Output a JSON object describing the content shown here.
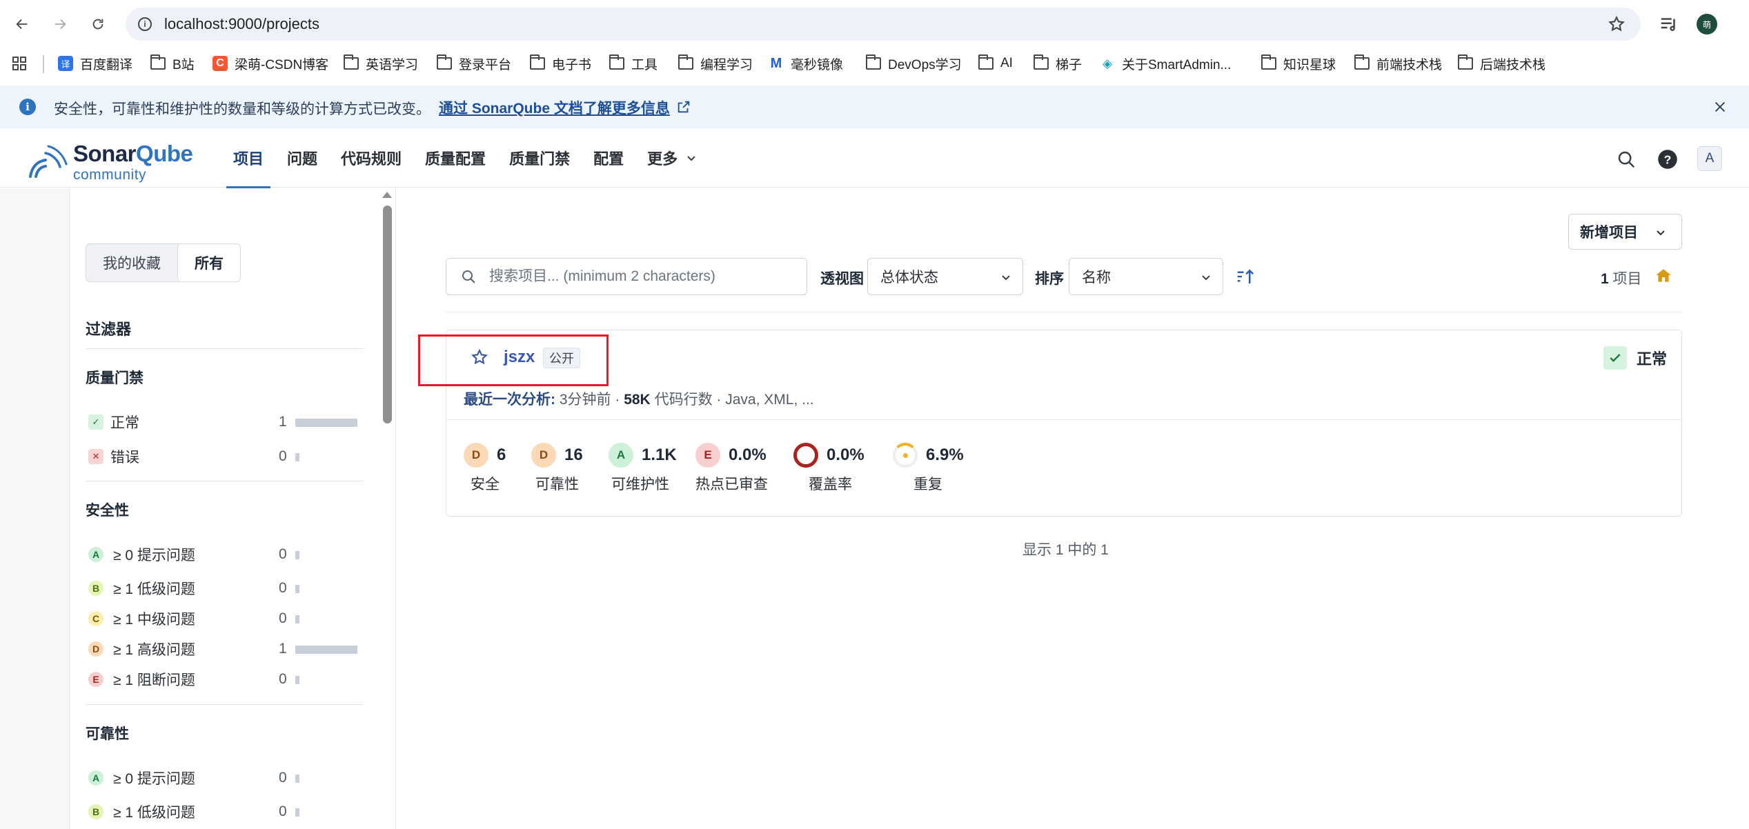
{
  "browser": {
    "url": "localhost:9000/projects",
    "profile_initial": "萌",
    "bookmarks": [
      {
        "label": "百度翻译",
        "icon": "baidu-translate-icon"
      },
      {
        "label": "B站",
        "icon": "folder-icon"
      },
      {
        "label": "梁萌-CSDN博客",
        "icon": "csdn-icon"
      },
      {
        "label": "英语学习",
        "icon": "folder-icon"
      },
      {
        "label": "登录平台",
        "icon": "folder-icon"
      },
      {
        "label": "电子书",
        "icon": "folder-icon"
      },
      {
        "label": "工具",
        "icon": "folder-icon"
      },
      {
        "label": "编程学习",
        "icon": "folder-icon"
      },
      {
        "label": "毫秒镜像",
        "icon": "millisecond-mirror-icon"
      },
      {
        "label": "DevOps学习",
        "icon": "folder-icon"
      },
      {
        "label": "AI",
        "icon": "folder-icon"
      },
      {
        "label": "梯子",
        "icon": "folder-icon"
      },
      {
        "label": "关于SmartAdmin...",
        "icon": "smartadmin-icon"
      },
      {
        "label": "知识星球",
        "icon": "folder-icon"
      },
      {
        "label": "前端技术栈",
        "icon": "folder-icon"
      },
      {
        "label": "后端技术栈",
        "icon": "folder-icon"
      }
    ]
  },
  "banner": {
    "message": "安全性，可靠性和维护性的数量和等级的计算方式已改变。",
    "link": "通过 SonarQube 文档了解更多信息"
  },
  "header": {
    "logo_word": "Sonar",
    "logo_word_accent": "Qube",
    "logo_edition": "community",
    "nav": [
      "项目",
      "问题",
      "代码规则",
      "质量配置",
      "质量门禁",
      "配置",
      "更多"
    ],
    "avatar": "A"
  },
  "sidebar": {
    "favorites": "我的收藏",
    "all": "所有",
    "filters_title": "过滤器",
    "quality_gate": {
      "title": "质量门禁",
      "rows": [
        {
          "label": "正常",
          "count": "1",
          "fraction": 1.0
        },
        {
          "label": "错误",
          "count": "0",
          "fraction": 0
        }
      ]
    },
    "security": {
      "title": "安全性",
      "rows": [
        {
          "rating": "A",
          "label": "≥ 0 提示问题",
          "count": "0",
          "fraction": 0
        },
        {
          "rating": "B",
          "label": "≥ 1 低级问题",
          "count": "0",
          "fraction": 0
        },
        {
          "rating": "C",
          "label": "≥ 1 中级问题",
          "count": "0",
          "fraction": 0
        },
        {
          "rating": "D",
          "label": "≥ 1 高级问题",
          "count": "1",
          "fraction": 1.0
        },
        {
          "rating": "E",
          "label": "≥ 1 阻断问题",
          "count": "0",
          "fraction": 0
        }
      ]
    },
    "reliability": {
      "title": "可靠性",
      "rows": [
        {
          "rating": "A",
          "label": "≥ 0 提示问题",
          "count": "0",
          "fraction": 0
        },
        {
          "rating": "B",
          "label": "≥ 1 低级问题",
          "count": "0",
          "fraction": 0
        }
      ]
    }
  },
  "main": {
    "new_project": "新增项目",
    "search_placeholder": "搜索项目... (minimum 2 characters)",
    "perspective_label": "透视图",
    "perspective_value": "总体状态",
    "sort_label": "排序",
    "sort_value": "名称",
    "count_number": "1",
    "count_unit": "项目",
    "project": {
      "name": "jszx",
      "visibility": "公开",
      "status": "正常",
      "meta_label": "最近一次分析:",
      "meta_time": "3分钟前",
      "meta_loc": "58K",
      "meta_loc_unit": "代码行数",
      "meta_langs": "Java, XML, ...",
      "metrics": [
        {
          "rating": "D",
          "value": "6",
          "label": "安全"
        },
        {
          "rating": "D",
          "value": "16",
          "label": "可靠性"
        },
        {
          "rating": "A",
          "value": "1.1K",
          "label": "可维护性"
        },
        {
          "rating": "E",
          "value": "0.0%",
          "label": "热点已审查"
        },
        {
          "rating": "",
          "value": "0.0%",
          "label": "覆盖率"
        },
        {
          "rating": "",
          "value": "6.9%",
          "label": "重复"
        }
      ]
    },
    "showing": "显示 1 中的 1"
  },
  "colors": {
    "accent": "#2f74c0",
    "status_ok": "#1b7b3e",
    "highlight_box": "#e41b23"
  }
}
